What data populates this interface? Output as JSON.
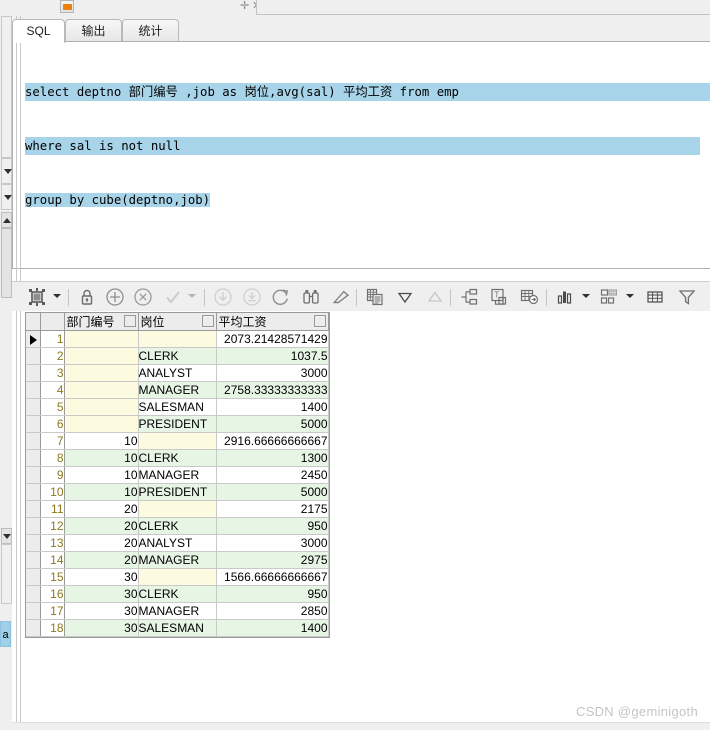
{
  "window": {
    "watermark": "CSDN @geminigoth"
  },
  "tabs": [
    {
      "id": "sql",
      "label": "SQL",
      "active": true
    },
    {
      "id": "out",
      "label": "输出",
      "active": false
    },
    {
      "id": "stat",
      "label": "统计",
      "active": false
    }
  ],
  "editor": {
    "lines": [
      "select deptno 部门编号 ,job as 岗位,avg(sal) 平均工资 from emp",
      "where sal is not null",
      "group by cube(deptno,job)"
    ],
    "selection_color": "#a8d4ea"
  },
  "toolbar": {
    "buttons": [
      {
        "name": "single-record-view-icon",
        "title": "单记录视图",
        "enabled": true
      },
      {
        "name": "lock-icon",
        "title": "锁定",
        "enabled": true
      },
      {
        "name": "add-record-icon",
        "title": "插入记录",
        "enabled": true
      },
      {
        "name": "delete-record-icon",
        "title": "删除记录",
        "enabled": true
      },
      {
        "name": "commit-check-icon",
        "title": "提交修改",
        "enabled": false
      },
      {
        "name": "fetch-next-page-icon",
        "title": "取下一页",
        "enabled": false
      },
      {
        "name": "fetch-last-page-icon",
        "title": "取最后一页",
        "enabled": false
      },
      {
        "name": "refresh-icon",
        "title": "刷新",
        "enabled": true
      },
      {
        "name": "binoculars-search-icon",
        "title": "查找",
        "enabled": true
      },
      {
        "name": "eraser-clear-icon",
        "title": "清除",
        "enabled": true
      },
      {
        "name": "copy-grid-icon",
        "title": "复制到剪贴板",
        "enabled": true
      },
      {
        "name": "sort-descending-icon",
        "title": "降序排序",
        "enabled": true
      },
      {
        "name": "sort-ascending-icon",
        "title": "升序排序",
        "enabled": false
      },
      {
        "name": "group-tree-icon",
        "title": "分组",
        "enabled": true
      },
      {
        "name": "transpose-icon",
        "title": "转置",
        "enabled": true
      },
      {
        "name": "export-grid-icon",
        "title": "导出结果",
        "enabled": true
      },
      {
        "name": "chart-icon",
        "title": "图表",
        "enabled": true
      },
      {
        "name": "layout-icon",
        "title": "布局",
        "enabled": true
      },
      {
        "name": "table-view-icon",
        "title": "表格视图",
        "enabled": true
      },
      {
        "name": "filter-icon",
        "title": "筛选",
        "enabled": true
      }
    ]
  },
  "grid": {
    "columns": [
      {
        "key": "deptno",
        "label": "部门编号"
      },
      {
        "key": "job",
        "label": "岗位"
      },
      {
        "key": "sal",
        "label": "平均工资"
      }
    ],
    "current_row": 1,
    "rows": [
      {
        "n": "1",
        "deptno": "",
        "job": "",
        "sal": "2073.21428571429"
      },
      {
        "n": "2",
        "deptno": "",
        "job": "CLERK",
        "sal": "1037.5"
      },
      {
        "n": "3",
        "deptno": "",
        "job": "ANALYST",
        "sal": "3000"
      },
      {
        "n": "4",
        "deptno": "",
        "job": "MANAGER",
        "sal": "2758.33333333333"
      },
      {
        "n": "5",
        "deptno": "",
        "job": "SALESMAN",
        "sal": "1400"
      },
      {
        "n": "6",
        "deptno": "",
        "job": "PRESIDENT",
        "sal": "5000"
      },
      {
        "n": "7",
        "deptno": "10",
        "job": "",
        "sal": "2916.66666666667"
      },
      {
        "n": "8",
        "deptno": "10",
        "job": "CLERK",
        "sal": "1300"
      },
      {
        "n": "9",
        "deptno": "10",
        "job": "MANAGER",
        "sal": "2450"
      },
      {
        "n": "10",
        "deptno": "10",
        "job": "PRESIDENT",
        "sal": "5000"
      },
      {
        "n": "11",
        "deptno": "20",
        "job": "",
        "sal": "2175"
      },
      {
        "n": "12",
        "deptno": "20",
        "job": "CLERK",
        "sal": "950"
      },
      {
        "n": "13",
        "deptno": "20",
        "job": "ANALYST",
        "sal": "3000"
      },
      {
        "n": "14",
        "deptno": "20",
        "job": "MANAGER",
        "sal": "2975"
      },
      {
        "n": "15",
        "deptno": "30",
        "job": "",
        "sal": "1566.66666666667"
      },
      {
        "n": "16",
        "deptno": "30",
        "job": "CLERK",
        "sal": "950"
      },
      {
        "n": "17",
        "deptno": "30",
        "job": "MANAGER",
        "sal": "2850"
      },
      {
        "n": "18",
        "deptno": "30",
        "job": "SALESMAN",
        "sal": "1400"
      }
    ]
  },
  "sidebar": {
    "bookmark_label": "a"
  },
  "colors": {
    "row_even": "#e6f5e4",
    "row_odd": "#ffffff",
    "null_cell": "#fcfbe0",
    "selection": "#a8d4ea",
    "header": "#ececec"
  }
}
